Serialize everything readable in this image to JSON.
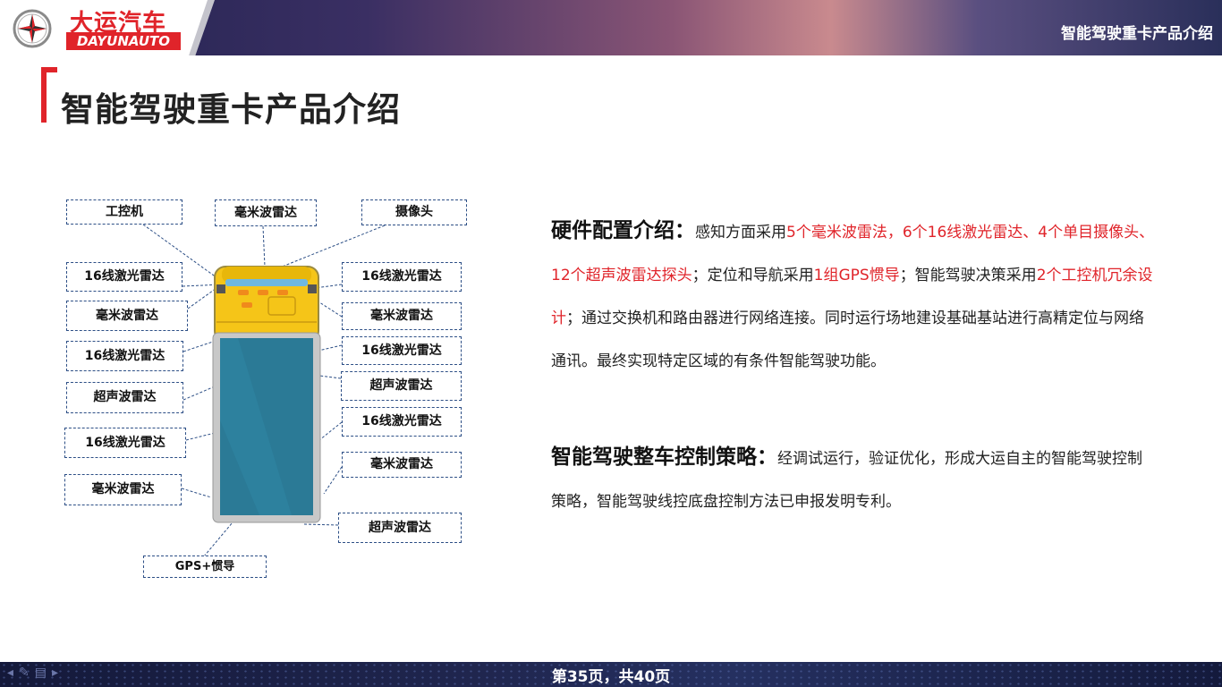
{
  "header": {
    "logo_cn": "大运汽车",
    "logo_en": "DAYUNAUTO",
    "title": "智能驾驶重卡产品介绍"
  },
  "page_title": "智能驾驶重卡产品介绍",
  "diagram": {
    "labels": {
      "ipc": "工控机",
      "mmwave_top": "毫米波雷达",
      "camera": "摄像头",
      "l_lidar_1": "16线激光雷达",
      "l_mmwave_1": "毫米波雷达",
      "l_lidar_2": "16线激光雷达",
      "l_ultrasonic": "超声波雷达",
      "l_lidar_3": "16线激光雷达",
      "l_mmwave_2": "毫米波雷达",
      "gps": "GPS+惯导",
      "r_lidar_1": "16线激光雷达",
      "r_mmwave_1": "毫米波雷达",
      "r_lidar_2": "16线激光雷达",
      "r_ultrasonic_1": "超声波雷达",
      "r_lidar_3": "16线激光雷达",
      "r_mmwave_2": "毫米波雷达",
      "r_ultrasonic_2": "超声波雷达"
    }
  },
  "hardware": {
    "heading": "硬件配置介绍：",
    "t1": "感知方面采用",
    "r1": "5个毫米波雷法，6个16线激光雷达、4个单目摄像头、12个超声波雷达探头",
    "t2": "；定位和导航采用",
    "r2": "1组GPS惯导",
    "t3": "；智能驾驶决策采用",
    "r3": "2个工控机冗余设计",
    "t4": "；通过交换机和路由器进行网络连接。同时运行场地建设基础基站进行高精定位与网络通讯。最终实现特定区域的有条件智能驾驶功能。"
  },
  "control": {
    "heading": "智能驾驶整车控制策略：",
    "text": "经调试运行，验证优化，形成大运自主的智能驾驶控制策略，智能驾驶线控底盘控制方法已申报发明专利。"
  },
  "footer": {
    "page": "第35页，共40页"
  },
  "colors": {
    "accent": "#e0242a",
    "cab": "#f5c518",
    "trailer": "#2b7a96",
    "banner": "#2a2f5a"
  }
}
